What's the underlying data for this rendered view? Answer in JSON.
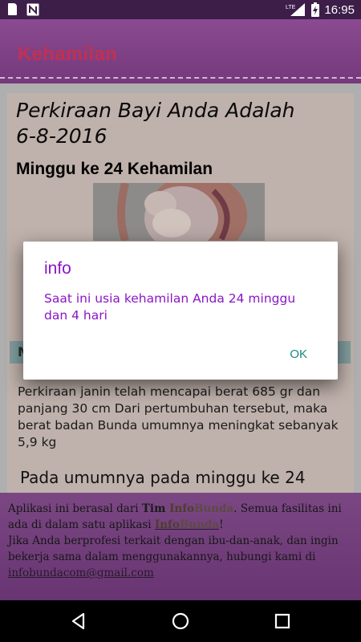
{
  "status_bar": {
    "time": "16:95",
    "network_label": "LTE",
    "icons": [
      "sd-card-icon",
      "n-notification-icon",
      "lte-signal-icon",
      "battery-charging-icon"
    ]
  },
  "app_bar": {
    "title": "Kehamilan"
  },
  "content": {
    "due_date_line1": "Perkiraan Bayi Anda Adalah",
    "due_date_line2": "6-8-2016",
    "week_title": "Minggu ke 24 Kehamilan",
    "section_bar_label": "M",
    "description": "Perkiraan janin telah mencapai berat 685 gr dan panjang 30 cm Dari pertumbuhan tersebut, maka berat badan Bunda umumnya meningkat sebanyak 5,9 kg",
    "section_heading": "Pada umumnya pada minggu ke 24"
  },
  "footer": {
    "intro": "Aplikasi ini berasal dari ",
    "tim": "Tim ",
    "info": "Info",
    "bunda": "Bunda",
    "rest1": ". Semua fasilitas ini ada di dalam satu aplikasi ",
    "link_info": "Info",
    "link_bunda": "Bunda",
    "rest2": "!",
    "line2": "Jika Anda berprofesi terkait dengan ibu-dan-anak, dan ingin bekerja sama dalam menggunakannya, hubungi kami di ",
    "email": "infobundacom@gmail.com"
  },
  "dialog": {
    "title": "info",
    "message": "Saat ini usia kehamilan Anda 24 minggu dan 4 hari",
    "ok_label": "OK"
  },
  "nav_bar": {
    "icons": [
      "back-icon",
      "home-icon",
      "recents-icon"
    ]
  },
  "colors": {
    "app_bar": "#7c3f82",
    "title_accent": "#c23053",
    "dialog_text": "#8a16c7",
    "dialog_button": "#178a7c"
  }
}
